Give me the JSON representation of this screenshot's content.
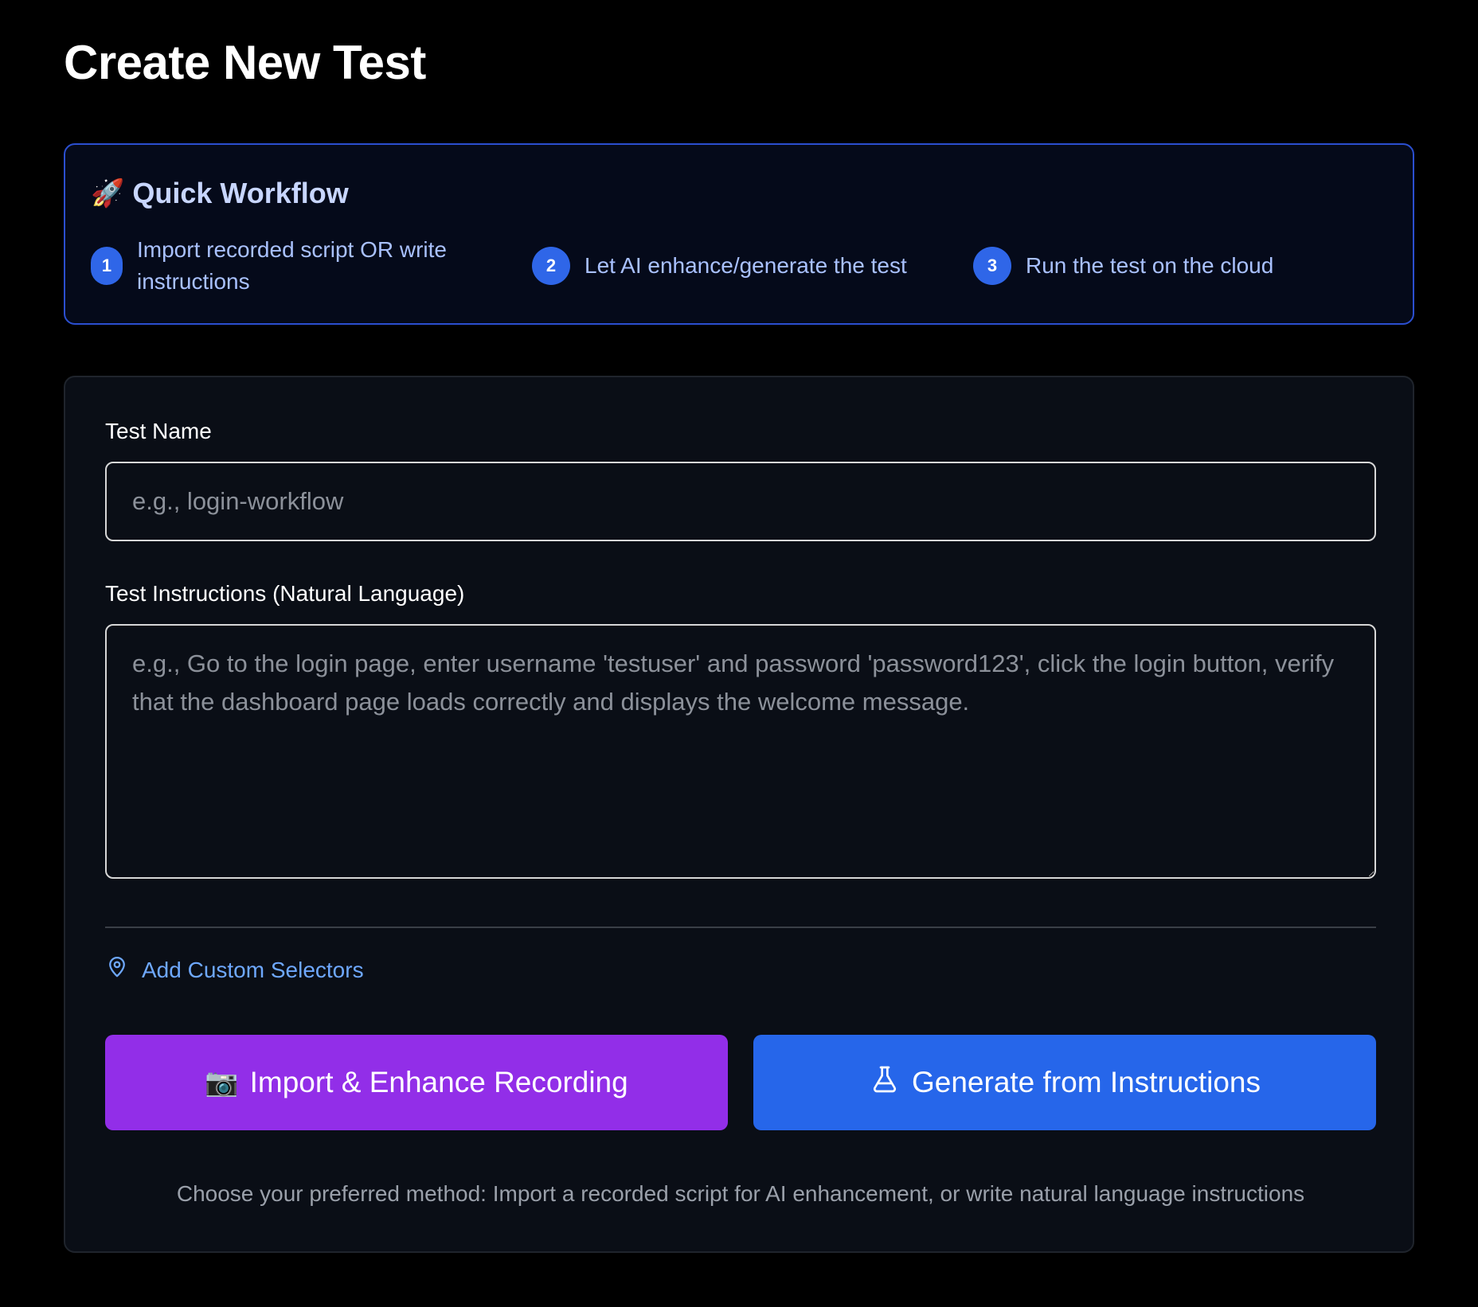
{
  "page": {
    "title": "Create New Test"
  },
  "workflow": {
    "icon": "🚀",
    "title": "Quick Workflow",
    "steps": [
      {
        "number": "1",
        "text": "Import recorded script OR write instructions"
      },
      {
        "number": "2",
        "text": "Let AI enhance/generate the test"
      },
      {
        "number": "3",
        "text": "Run the test on the cloud"
      }
    ]
  },
  "form": {
    "test_name": {
      "label": "Test Name",
      "value": "",
      "placeholder": "e.g., login-workflow"
    },
    "instructions": {
      "label": "Test Instructions (Natural Language)",
      "value": "",
      "placeholder": "e.g., Go to the login page, enter username 'testuser' and password 'password123', click the login button, verify that the dashboard page loads correctly and displays the welcome message."
    },
    "custom_selectors": {
      "label": "Add Custom Selectors",
      "icon": "map-pin-icon"
    },
    "buttons": {
      "import": {
        "icon": "📷",
        "label": "Import & Enhance Recording"
      },
      "generate": {
        "icon": "flask-icon",
        "label": "Generate from Instructions"
      }
    },
    "note": "Choose your preferred method: Import a recorded script for AI enhancement, or write natural language instructions"
  },
  "colors": {
    "background": "#000000",
    "card_background": "#0a0e16",
    "workflow_border": "#2b4fd0",
    "step_badge": "#2f66e8",
    "link": "#6ea8ff",
    "import_button": "#922ee8",
    "generate_button": "#2666ea"
  }
}
